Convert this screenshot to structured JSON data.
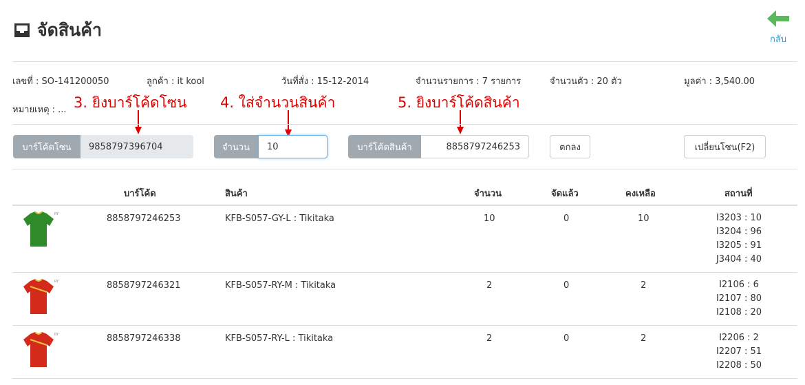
{
  "header": {
    "title": "จัดสินค้า",
    "title_icon": "inbox-icon",
    "back_label": "กลับ",
    "back_icon": "arrow-left-icon",
    "back_color": "#5cb85c"
  },
  "order": {
    "number": "เลขที่ : SO-141200050",
    "customer": "ลูกค้า : it kool",
    "date": "วันที่สั่ง : 15-12-2014",
    "item_count": "จำนวนรายการ : 7 รายการ",
    "unit_count": "จำนวนตัว : 20 ตัว",
    "value": "มูลค่า : 3,540.00",
    "note": "หมายเหตุ : ..."
  },
  "annotations": {
    "step3": "3. ยิงบาร์โค้ดโซน",
    "step4": "4. ใส่จำนวนสินค้า",
    "step5": "5. ยิงบาร์โค้ดสินค้า",
    "color": "#e00000"
  },
  "form": {
    "zone_label": "บาร์โค้ดโซน",
    "zone_value": "9858797396704",
    "qty_label": "จำนวน",
    "qty_value": "10",
    "product_label": "บาร์โค้ดสินค้า",
    "product_value": "8858797246253",
    "ok_label": "ตกลง",
    "change_zone_label": "เปลี่ยนโซน(F2)"
  },
  "table": {
    "headers": {
      "barcode": "บาร์โค้ด",
      "product": "สินค้า",
      "qty": "จำนวน",
      "picked": "จัดแล้ว",
      "remaining": "คงเหลือ",
      "location": "สถานที่"
    },
    "rows": [
      {
        "barcode": "8858797246253",
        "product": "KFB-S057-GY-L : Tikitaka",
        "qty": "10",
        "picked": "0",
        "remaining": "10",
        "shirt_color": "#2f8a2a",
        "locations": [
          "I3203 : 10",
          "I3204 : 96",
          "I3205 : 91",
          "J3404 : 40"
        ]
      },
      {
        "barcode": "8858797246321",
        "product": "KFB-S057-RY-M : Tikitaka",
        "qty": "2",
        "picked": "0",
        "remaining": "2",
        "shirt_color": "#d42a1c",
        "locations": [
          "I2106 : 6",
          "I2107 : 80",
          "I2108 : 20"
        ]
      },
      {
        "barcode": "8858797246338",
        "product": "KFB-S057-RY-L : Tikitaka",
        "qty": "2",
        "picked": "0",
        "remaining": "2",
        "shirt_color": "#d42a1c",
        "locations": [
          "I2206 : 2",
          "I2207 : 51",
          "I2208 : 50"
        ]
      }
    ]
  }
}
